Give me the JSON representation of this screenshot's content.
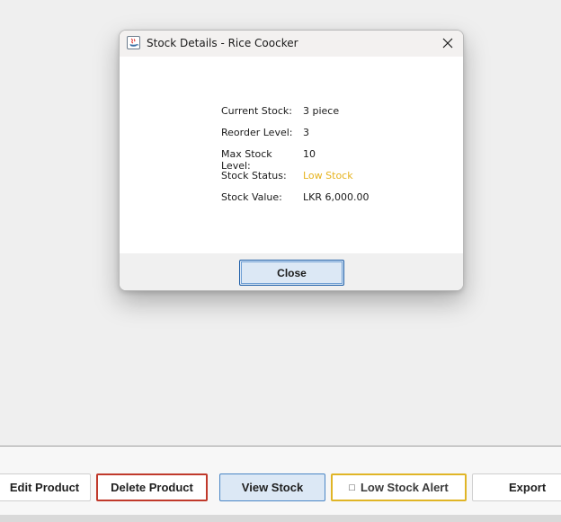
{
  "dialog": {
    "title": "Stock Details - Rice Coocker",
    "rows": [
      {
        "label": "Current Stock:",
        "value": "3 piece"
      },
      {
        "label": "Reorder Level:",
        "value": "3"
      },
      {
        "label": "Max Stock Level:",
        "value": "10"
      },
      {
        "label": "Stock Status:",
        "value": "Low Stock"
      },
      {
        "label": "Stock Value:",
        "value": "LKR 6,000.00"
      }
    ],
    "close_label": "Close",
    "status_color": "#e6b31e"
  },
  "toolbar": {
    "edit_label": "Edit Product",
    "delete_label": "Delete Product",
    "view_label": "View Stock",
    "low_stock_icon": "□",
    "low_stock_label": "Low Stock Alert",
    "export_label": "Export"
  },
  "colors": {
    "delete_border": "#c0392b",
    "view_bg": "#dce8f5",
    "view_border": "#4a86c5",
    "alert_border": "#e0b526"
  }
}
